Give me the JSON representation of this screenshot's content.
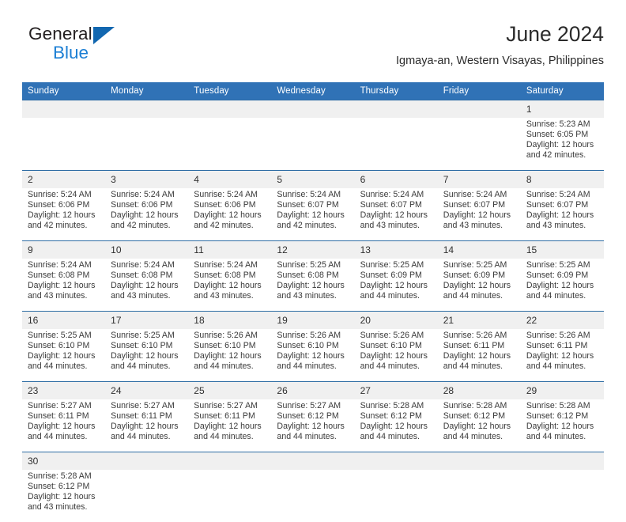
{
  "brand": {
    "name_part1": "General",
    "name_part2": "Blue",
    "flag_icon": "blue-triangle-flag-icon"
  },
  "header": {
    "title": "June 2024",
    "subtitle": "Igmaya-an, Western Visayas, Philippines"
  },
  "colors": {
    "header_blue": "#3072b6",
    "rule_blue": "#2e6da4",
    "daynum_band": "#f0f0f0",
    "brand_blue": "#1c7fd4",
    "text": "#3a3a3a"
  },
  "weekday_headers": [
    "Sunday",
    "Monday",
    "Tuesday",
    "Wednesday",
    "Thursday",
    "Friday",
    "Saturday"
  ],
  "weeks": [
    {
      "days": [
        {
          "num": "",
          "lines": []
        },
        {
          "num": "",
          "lines": []
        },
        {
          "num": "",
          "lines": []
        },
        {
          "num": "",
          "lines": []
        },
        {
          "num": "",
          "lines": []
        },
        {
          "num": "",
          "lines": []
        },
        {
          "num": "1",
          "lines": [
            "Sunrise: 5:23 AM",
            "Sunset: 6:05 PM",
            "Daylight: 12 hours",
            "and 42 minutes."
          ]
        }
      ]
    },
    {
      "days": [
        {
          "num": "2",
          "lines": [
            "Sunrise: 5:24 AM",
            "Sunset: 6:06 PM",
            "Daylight: 12 hours",
            "and 42 minutes."
          ]
        },
        {
          "num": "3",
          "lines": [
            "Sunrise: 5:24 AM",
            "Sunset: 6:06 PM",
            "Daylight: 12 hours",
            "and 42 minutes."
          ]
        },
        {
          "num": "4",
          "lines": [
            "Sunrise: 5:24 AM",
            "Sunset: 6:06 PM",
            "Daylight: 12 hours",
            "and 42 minutes."
          ]
        },
        {
          "num": "5",
          "lines": [
            "Sunrise: 5:24 AM",
            "Sunset: 6:07 PM",
            "Daylight: 12 hours",
            "and 42 minutes."
          ]
        },
        {
          "num": "6",
          "lines": [
            "Sunrise: 5:24 AM",
            "Sunset: 6:07 PM",
            "Daylight: 12 hours",
            "and 43 minutes."
          ]
        },
        {
          "num": "7",
          "lines": [
            "Sunrise: 5:24 AM",
            "Sunset: 6:07 PM",
            "Daylight: 12 hours",
            "and 43 minutes."
          ]
        },
        {
          "num": "8",
          "lines": [
            "Sunrise: 5:24 AM",
            "Sunset: 6:07 PM",
            "Daylight: 12 hours",
            "and 43 minutes."
          ]
        }
      ]
    },
    {
      "days": [
        {
          "num": "9",
          "lines": [
            "Sunrise: 5:24 AM",
            "Sunset: 6:08 PM",
            "Daylight: 12 hours",
            "and 43 minutes."
          ]
        },
        {
          "num": "10",
          "lines": [
            "Sunrise: 5:24 AM",
            "Sunset: 6:08 PM",
            "Daylight: 12 hours",
            "and 43 minutes."
          ]
        },
        {
          "num": "11",
          "lines": [
            "Sunrise: 5:24 AM",
            "Sunset: 6:08 PM",
            "Daylight: 12 hours",
            "and 43 minutes."
          ]
        },
        {
          "num": "12",
          "lines": [
            "Sunrise: 5:25 AM",
            "Sunset: 6:08 PM",
            "Daylight: 12 hours",
            "and 43 minutes."
          ]
        },
        {
          "num": "13",
          "lines": [
            "Sunrise: 5:25 AM",
            "Sunset: 6:09 PM",
            "Daylight: 12 hours",
            "and 44 minutes."
          ]
        },
        {
          "num": "14",
          "lines": [
            "Sunrise: 5:25 AM",
            "Sunset: 6:09 PM",
            "Daylight: 12 hours",
            "and 44 minutes."
          ]
        },
        {
          "num": "15",
          "lines": [
            "Sunrise: 5:25 AM",
            "Sunset: 6:09 PM",
            "Daylight: 12 hours",
            "and 44 minutes."
          ]
        }
      ]
    },
    {
      "days": [
        {
          "num": "16",
          "lines": [
            "Sunrise: 5:25 AM",
            "Sunset: 6:10 PM",
            "Daylight: 12 hours",
            "and 44 minutes."
          ]
        },
        {
          "num": "17",
          "lines": [
            "Sunrise: 5:25 AM",
            "Sunset: 6:10 PM",
            "Daylight: 12 hours",
            "and 44 minutes."
          ]
        },
        {
          "num": "18",
          "lines": [
            "Sunrise: 5:26 AM",
            "Sunset: 6:10 PM",
            "Daylight: 12 hours",
            "and 44 minutes."
          ]
        },
        {
          "num": "19",
          "lines": [
            "Sunrise: 5:26 AM",
            "Sunset: 6:10 PM",
            "Daylight: 12 hours",
            "and 44 minutes."
          ]
        },
        {
          "num": "20",
          "lines": [
            "Sunrise: 5:26 AM",
            "Sunset: 6:10 PM",
            "Daylight: 12 hours",
            "and 44 minutes."
          ]
        },
        {
          "num": "21",
          "lines": [
            "Sunrise: 5:26 AM",
            "Sunset: 6:11 PM",
            "Daylight: 12 hours",
            "and 44 minutes."
          ]
        },
        {
          "num": "22",
          "lines": [
            "Sunrise: 5:26 AM",
            "Sunset: 6:11 PM",
            "Daylight: 12 hours",
            "and 44 minutes."
          ]
        }
      ]
    },
    {
      "days": [
        {
          "num": "23",
          "lines": [
            "Sunrise: 5:27 AM",
            "Sunset: 6:11 PM",
            "Daylight: 12 hours",
            "and 44 minutes."
          ]
        },
        {
          "num": "24",
          "lines": [
            "Sunrise: 5:27 AM",
            "Sunset: 6:11 PM",
            "Daylight: 12 hours",
            "and 44 minutes."
          ]
        },
        {
          "num": "25",
          "lines": [
            "Sunrise: 5:27 AM",
            "Sunset: 6:11 PM",
            "Daylight: 12 hours",
            "and 44 minutes."
          ]
        },
        {
          "num": "26",
          "lines": [
            "Sunrise: 5:27 AM",
            "Sunset: 6:12 PM",
            "Daylight: 12 hours",
            "and 44 minutes."
          ]
        },
        {
          "num": "27",
          "lines": [
            "Sunrise: 5:28 AM",
            "Sunset: 6:12 PM",
            "Daylight: 12 hours",
            "and 44 minutes."
          ]
        },
        {
          "num": "28",
          "lines": [
            "Sunrise: 5:28 AM",
            "Sunset: 6:12 PM",
            "Daylight: 12 hours",
            "and 44 minutes."
          ]
        },
        {
          "num": "29",
          "lines": [
            "Sunrise: 5:28 AM",
            "Sunset: 6:12 PM",
            "Daylight: 12 hours",
            "and 44 minutes."
          ]
        }
      ]
    },
    {
      "days": [
        {
          "num": "30",
          "lines": [
            "Sunrise: 5:28 AM",
            "Sunset: 6:12 PM",
            "Daylight: 12 hours",
            "and 43 minutes."
          ]
        },
        {
          "num": "",
          "lines": []
        },
        {
          "num": "",
          "lines": []
        },
        {
          "num": "",
          "lines": []
        },
        {
          "num": "",
          "lines": []
        },
        {
          "num": "",
          "lines": []
        },
        {
          "num": "",
          "lines": []
        }
      ]
    }
  ]
}
